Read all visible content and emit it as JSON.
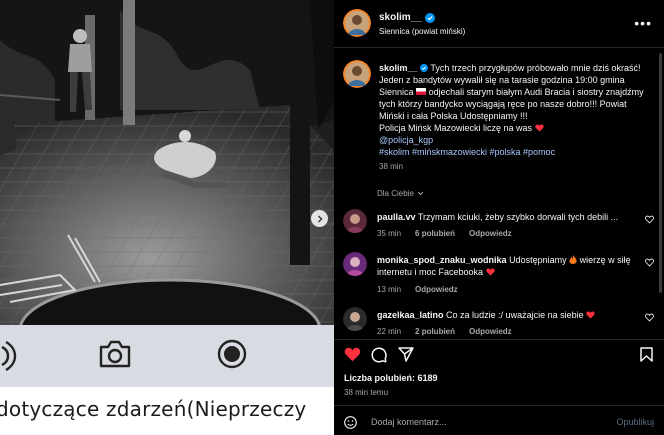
{
  "media": {
    "caption_partial": "dotyczące zdarzeń(Nieprzeczy",
    "controls": [
      "speaker-icon",
      "camera-icon",
      "record-icon"
    ],
    "next_icon": "chevron-right-icon"
  },
  "post": {
    "author": {
      "username": "skolim__",
      "location": "Siennica (powiat miński)",
      "verified": true
    },
    "more_icon": "•••",
    "caption": {
      "username": "skolim__",
      "text_1": "Tych trzech przygłupów próbowało mnie dziś okraść! Jeden z bandytów wywalił się na tarasie godzina 19:00 gmina Siennica",
      "text_2": "odjechali starym białym Audi Bracia i siostry znajdźmy tych którzy bandycko wyciągają ręce po nasze dobro!!! Powiat Miński i cała Polska Udostępniamy !!!",
      "text_3": "Policja Mińsk Mazowiecki liczę na was",
      "mention": "@policja_kgp",
      "hashtags": "#skolim #mińskmazowiecki #polska #pomoc",
      "time": "38 min"
    },
    "for_you_label": "Dla Ciebie",
    "comments": [
      {
        "username": "paulla.vv",
        "text": "Trzymam kciuki, żeby szybko dorwali tych debili ...",
        "time": "35 min",
        "likes": "6 polubień",
        "reply": "Odpowiedz"
      },
      {
        "username": "monika_spod_znaku_wodnika",
        "text_1": "Udostępniamy",
        "text_2": "wierzę w siłę internetu i moc Facebooka",
        "time": "13 min",
        "reply": "Odpowiedz"
      },
      {
        "username": "gazelkaa_latino",
        "text": "Co za ludzie :/ uważajcie na siebie",
        "time": "22 min",
        "likes": "2 polubień",
        "reply": "Odpowiedz"
      }
    ],
    "likes_count": "Liczba polubień: 6189",
    "posted_ago": "38 min temu",
    "add_comment_placeholder": "Dodaj komentarz...",
    "publish_label": "Opublikuj",
    "colors": {
      "background": "#000000",
      "text": "#f5f5f5",
      "muted": "#a8a8a8",
      "link": "#a8c7fa",
      "like_red": "#ff3040",
      "verified_blue": "#0095f6"
    }
  }
}
